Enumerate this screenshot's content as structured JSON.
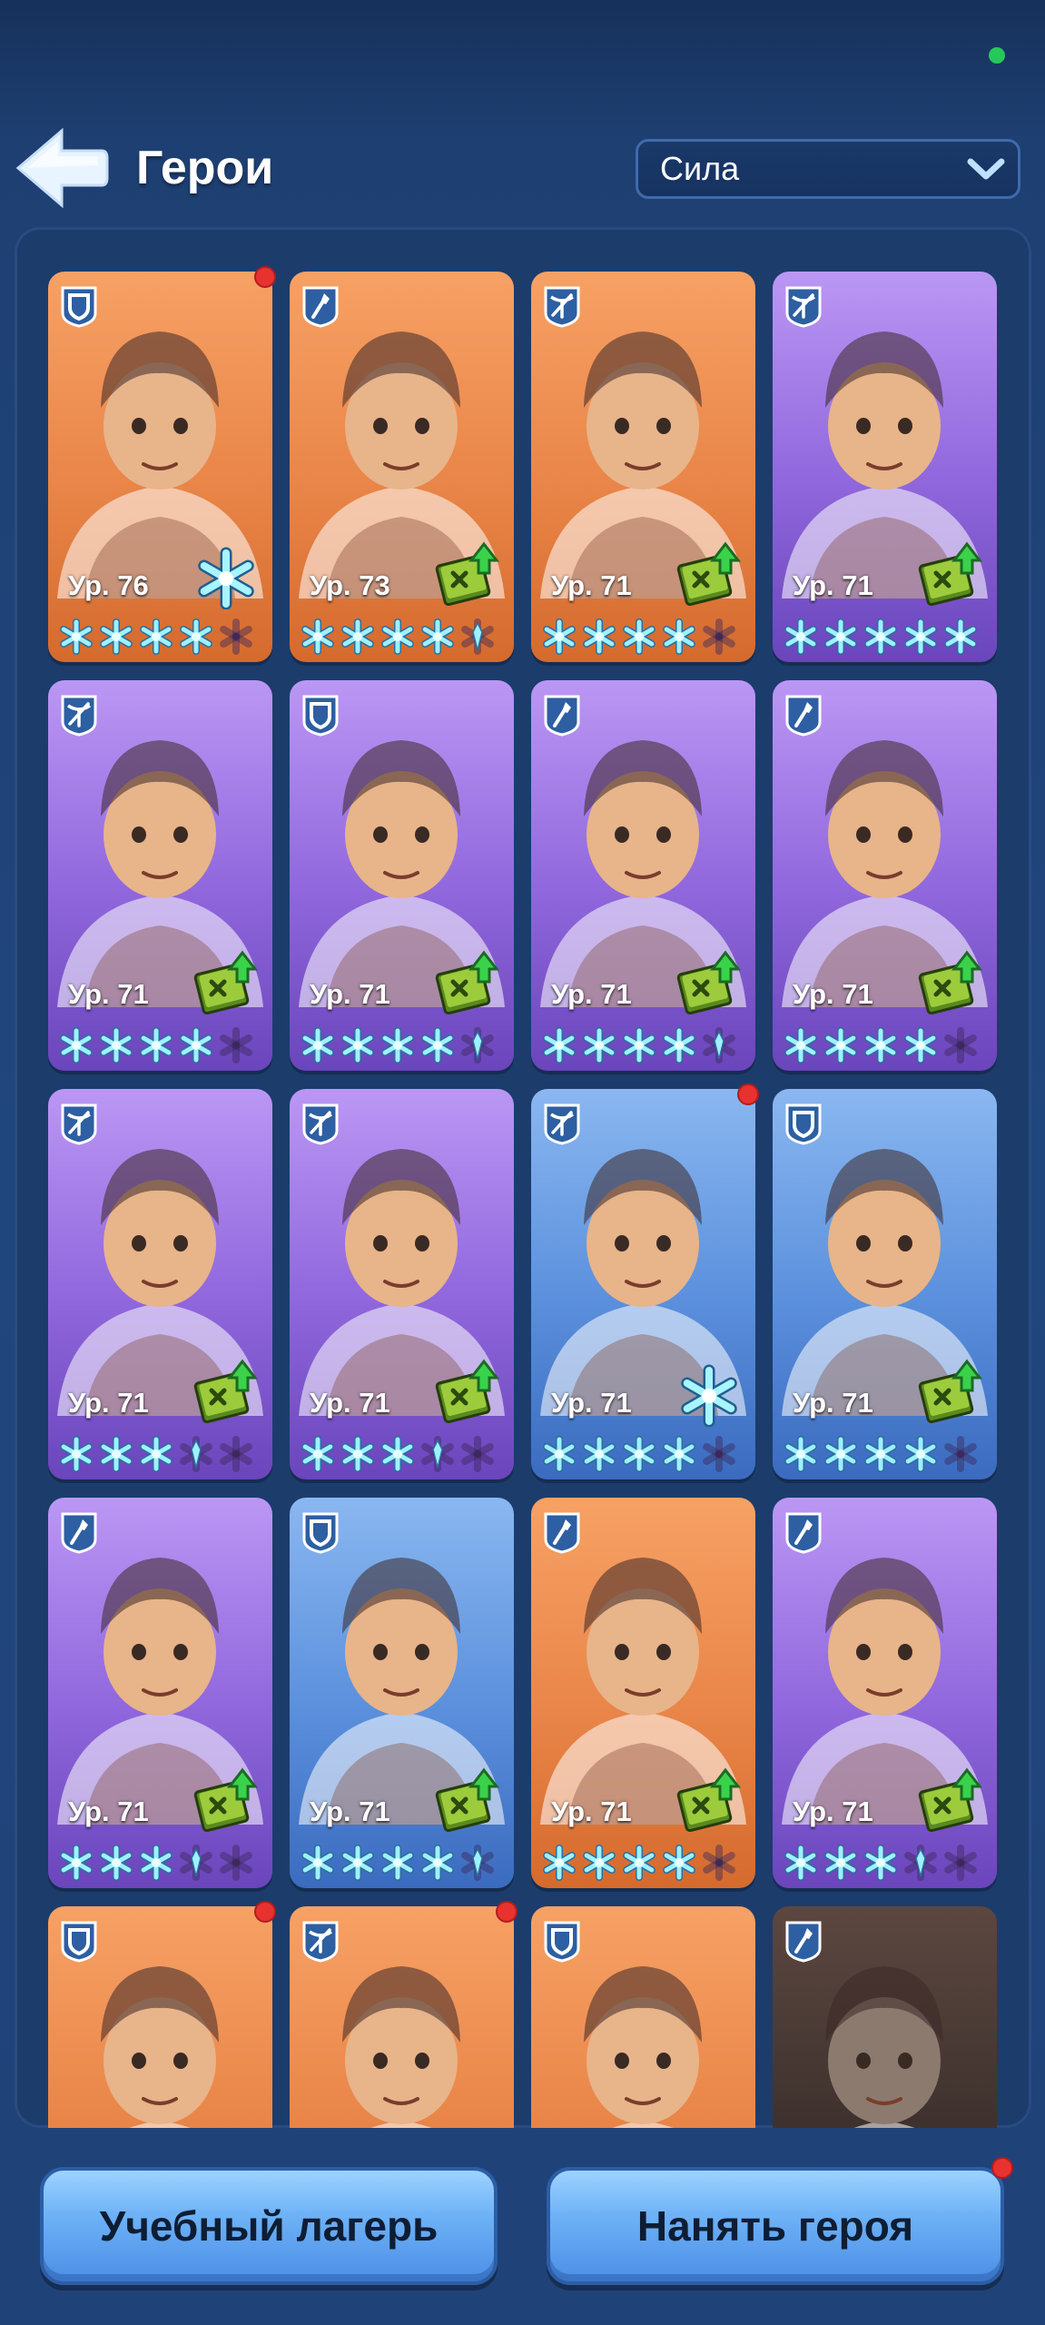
{
  "header": {
    "title": "Герои",
    "sort_value": "Сила"
  },
  "colors": {
    "orange_card": "#e98548",
    "purple_card": "#8f66dc",
    "blue_card": "#5a8fdc",
    "notification": "#e8322f",
    "status": "#27c85a"
  },
  "heroes": [
    {
      "level": "Ур. 76",
      "class": "shield",
      "bg": "orange",
      "stars": 4,
      "half_star": false,
      "badge": "snowflake",
      "notify": true
    },
    {
      "level": "Ур. 73",
      "class": "shovel",
      "bg": "orange",
      "stars": 4,
      "half_star": true,
      "badge": "upgrade",
      "notify": false
    },
    {
      "level": "Ур. 71",
      "class": "crossbow",
      "bg": "orange",
      "stars": 4,
      "half_star": false,
      "badge": "upgrade",
      "notify": false
    },
    {
      "level": "Ур. 71",
      "class": "crossbow",
      "bg": "purple",
      "stars": 5,
      "half_star": false,
      "badge": "upgrade",
      "notify": false
    },
    {
      "level": "Ур. 71",
      "class": "crossbow",
      "bg": "purple",
      "stars": 4,
      "half_star": false,
      "badge": "upgrade",
      "notify": false
    },
    {
      "level": "Ур. 71",
      "class": "shield",
      "bg": "purple",
      "stars": 4,
      "half_star": true,
      "badge": "upgrade",
      "notify": false
    },
    {
      "level": "Ур. 71",
      "class": "shovel",
      "bg": "purple",
      "stars": 4,
      "half_star": true,
      "badge": "upgrade",
      "notify": false
    },
    {
      "level": "Ур. 71",
      "class": "shovel",
      "bg": "purple",
      "stars": 4,
      "half_star": false,
      "badge": "upgrade",
      "notify": false
    },
    {
      "level": "Ур. 71",
      "class": "crossbow",
      "bg": "purple",
      "stars": 3,
      "half_star": true,
      "badge": "upgrade",
      "notify": false
    },
    {
      "level": "Ур. 71",
      "class": "crossbow",
      "bg": "purple",
      "stars": 3,
      "half_star": true,
      "badge": "upgrade",
      "notify": false
    },
    {
      "level": "Ур. 71",
      "class": "crossbow",
      "bg": "blue",
      "stars": 4,
      "half_star": false,
      "badge": "snowflake",
      "notify": true
    },
    {
      "level": "Ур. 71",
      "class": "shield",
      "bg": "blue",
      "stars": 4,
      "half_star": false,
      "badge": "upgrade",
      "notify": false
    },
    {
      "level": "Ур. 71",
      "class": "shovel",
      "bg": "purple",
      "stars": 3,
      "half_star": true,
      "badge": "upgrade",
      "notify": false
    },
    {
      "level": "Ур. 71",
      "class": "shield",
      "bg": "blue",
      "stars": 4,
      "half_star": true,
      "badge": "upgrade",
      "notify": false
    },
    {
      "level": "Ур. 71",
      "class": "shovel",
      "bg": "orange",
      "stars": 4,
      "half_star": false,
      "badge": "upgrade",
      "notify": false
    },
    {
      "level": "Ур. 71",
      "class": "shovel",
      "bg": "purple",
      "stars": 3,
      "half_star": true,
      "badge": "upgrade",
      "notify": false
    },
    {
      "level": "",
      "class": "shield",
      "bg": "orange",
      "stars": 0,
      "half_star": false,
      "badge": "",
      "notify": true
    },
    {
      "level": "",
      "class": "crossbow",
      "bg": "orange",
      "stars": 0,
      "half_star": false,
      "badge": "",
      "notify": true
    },
    {
      "level": "",
      "class": "shield",
      "bg": "orange",
      "stars": 0,
      "half_star": false,
      "badge": "",
      "notify": false
    },
    {
      "level": "",
      "class": "shovel",
      "bg": "dark",
      "stars": 0,
      "half_star": false,
      "badge": "",
      "notify": false
    }
  ],
  "footer": {
    "camp_label": "Учебный лагерь",
    "hire_label": "Нанять героя",
    "hire_notify": true
  }
}
